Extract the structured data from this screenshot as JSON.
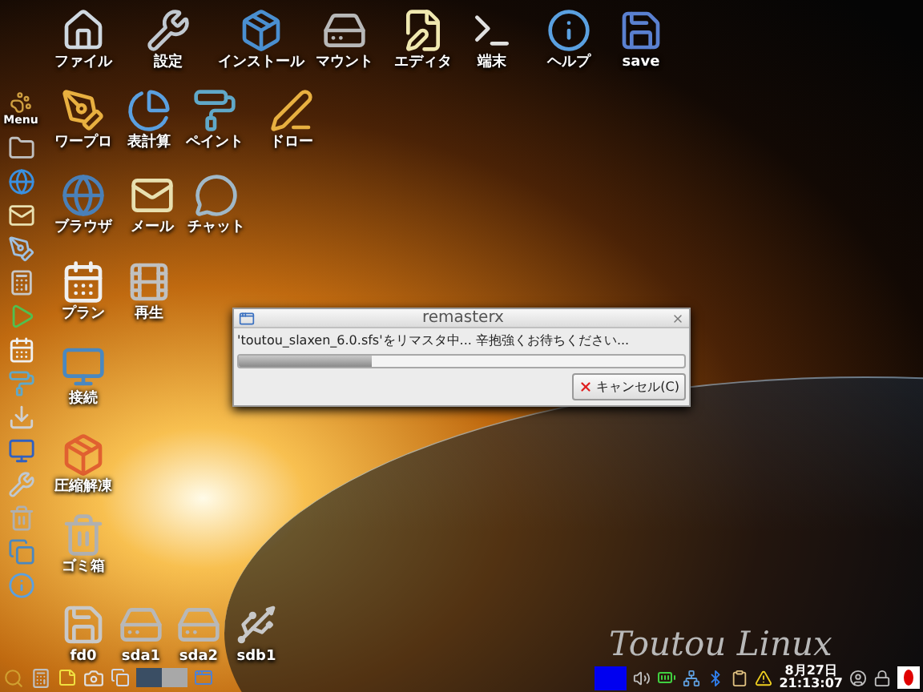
{
  "desktop_icons": [
    {
      "label": "ファイル",
      "kind": "home"
    },
    {
      "label": "設定",
      "kind": "tools"
    },
    {
      "label": "インストール",
      "kind": "package"
    },
    {
      "label": "マウント",
      "kind": "drive"
    },
    {
      "label": "エディタ",
      "kind": "editor"
    },
    {
      "label": "端末",
      "kind": "terminal"
    },
    {
      "label": "ヘルプ",
      "kind": "info"
    },
    {
      "label": "save",
      "kind": "save"
    },
    {
      "label": "ワープロ",
      "kind": "pen"
    },
    {
      "label": "表計算",
      "kind": "chart"
    },
    {
      "label": "ペイント",
      "kind": "roller"
    },
    {
      "label": "ドロー",
      "kind": "draw"
    },
    {
      "label": "ブラウザ",
      "kind": "globe"
    },
    {
      "label": "メール",
      "kind": "mail"
    },
    {
      "label": "チャット",
      "kind": "chat"
    },
    {
      "label": "プラン",
      "kind": "calendar"
    },
    {
      "label": "再生",
      "kind": "media"
    },
    {
      "label": "接続",
      "kind": "monitor"
    },
    {
      "label": "圧縮解凍",
      "kind": "archive"
    },
    {
      "label": "ゴミ箱",
      "kind": "trash"
    },
    {
      "label": "fd0",
      "kind": "floppy"
    },
    {
      "label": "sda1",
      "kind": "drive"
    },
    {
      "label": "sda2",
      "kind": "drive"
    },
    {
      "label": "sdb1",
      "kind": "usb"
    }
  ],
  "dock": {
    "menu_label": "Menu"
  },
  "dialog": {
    "title": "remasterx",
    "message": "'toutou_slaxen_6.0.sfs'をリマスタ中... 辛抱強くお待ちください...",
    "progress": {
      "level": 0.3
    },
    "cancel_button": "キャンセル(C)"
  },
  "brand": "Toutou Linux",
  "taskbar": {
    "workspaces": [
      {
        "selected": true
      },
      {
        "selected": false
      }
    ],
    "clock_date": "8月27日",
    "clock_time": "21:13:07"
  }
}
